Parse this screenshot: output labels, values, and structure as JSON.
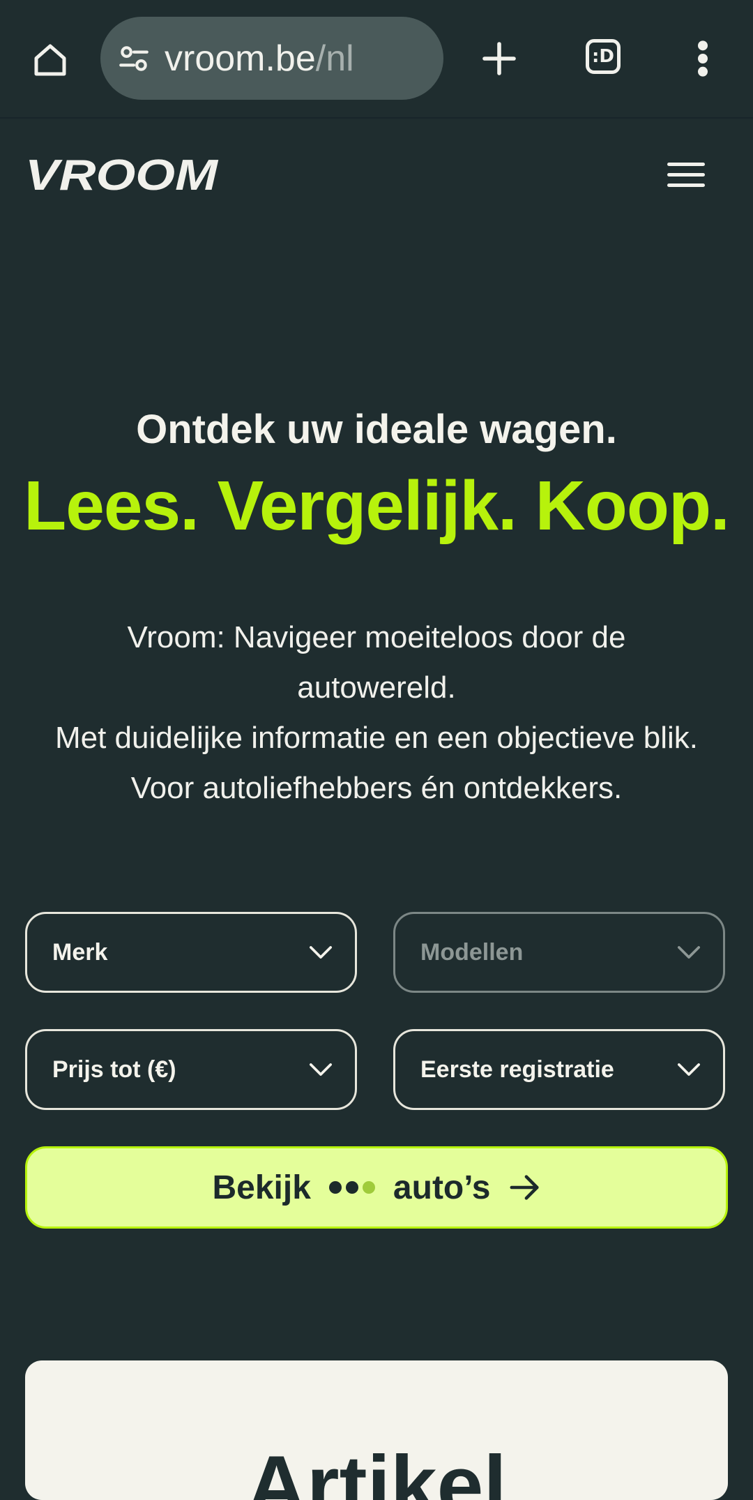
{
  "browser": {
    "url_host": "vroom.be",
    "url_path": "/nl",
    "tabs_label": ":D"
  },
  "site": {
    "logo_text": "VROOM"
  },
  "hero": {
    "title": "Ontdek uw ideale wagen.",
    "tagline": "Lees. Vergelijk. Koop.",
    "description_lines": [
      "Vroom: Navigeer moeiteloos door de",
      "autowereld.",
      "Met duidelijke informatie en een objectieve blik.",
      "Voor autoliefhebbers én ontdekkers."
    ]
  },
  "filters": {
    "brand": "Merk",
    "models": "Modellen",
    "price": "Prijs tot (€)",
    "registration": "Eerste registratie"
  },
  "cta": {
    "label_start": "Bekijk",
    "label_end": "auto’s"
  },
  "section": {
    "title_partial": "Artikel"
  },
  "colors": {
    "background": "#1f2d2f",
    "accent": "#b7f20c",
    "cta_fill": "#e4fe9a"
  }
}
